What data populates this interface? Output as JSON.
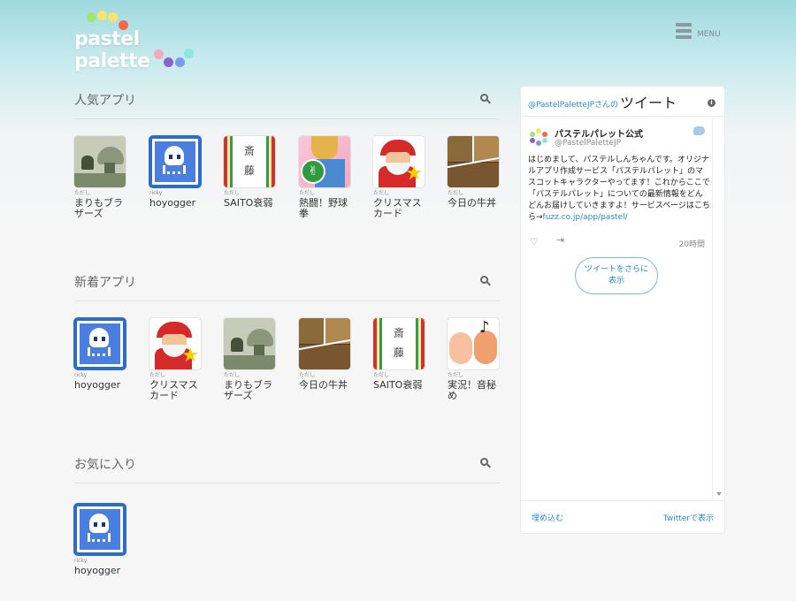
{
  "header": {
    "logo_text": "pastel palette",
    "menu_label": "MENU"
  },
  "colors": {
    "accent": "#2a8ccb",
    "logo_dots": [
      "#a6e27a",
      "#f5e56b",
      "#f06a4a",
      "#f4a8c0",
      "#8a63d2",
      "#7a9ae8",
      "#8de7e0"
    ]
  },
  "sections": [
    {
      "title": "人気アプリ",
      "apps": [
        {
          "author": "ただし",
          "name": "まりもブラザーズ",
          "thumb": "mario"
        },
        {
          "author": "ricky",
          "name": "hoyogger",
          "thumb": "squid"
        },
        {
          "author": "ただし",
          "name": "SAITO衰弱",
          "thumb": "saito"
        },
        {
          "author": "ただし",
          "name": "熱闘！野球拳",
          "thumb": "fight"
        },
        {
          "author": "ただし",
          "name": "クリスマスカード",
          "thumb": "xmas"
        },
        {
          "author": "ただし",
          "name": "今日の牛丼",
          "thumb": "beef"
        }
      ]
    },
    {
      "title": "新着アプリ",
      "apps": [
        {
          "author": "ricky",
          "name": "hoyogger",
          "thumb": "squid"
        },
        {
          "author": "ただし",
          "name": "クリスマスカード",
          "thumb": "xmas"
        },
        {
          "author": "ただし",
          "name": "まりもブラザーズ",
          "thumb": "mario"
        },
        {
          "author": "ただし",
          "name": "今日の牛丼",
          "thumb": "beef"
        },
        {
          "author": "ただし",
          "name": "SAITO衰弱",
          "thumb": "saito"
        },
        {
          "author": "ただし",
          "name": "実況！音秘め",
          "thumb": "live"
        }
      ]
    },
    {
      "title": "お気に入り",
      "apps": [
        {
          "author": "ricky",
          "name": "hoyogger",
          "thumb": "squid"
        }
      ]
    }
  ],
  "thumb_text": {
    "saito_top": "斎",
    "saito_bottom": "藤",
    "fight_badge": "✌",
    "xmas_star": "★",
    "live_note": "♪"
  },
  "twitter": {
    "user": "@PastelPaletteJPさんの",
    "title": "ツイート",
    "info": "i",
    "tweet": {
      "name": "パステルパレット公式",
      "handle": "@PastelPaletteJP",
      "text": "はじめまして、パステルしんちゃんです。オリジナルアプリ作成サービス「パステルパレット」のマスコットキャラクターやってます！これからここで「パステルパレット」についての最新情報をどんどんお届けしていきますよ！サービスページはこちら→",
      "link": "fuzz.co.jp/app/pastel/",
      "heart": "♡",
      "share": "⇥",
      "time": "20時間"
    },
    "more_button": "ツイートをさらに表示",
    "embed_link": "埋め込む",
    "view_link": "Twitterで表示"
  }
}
